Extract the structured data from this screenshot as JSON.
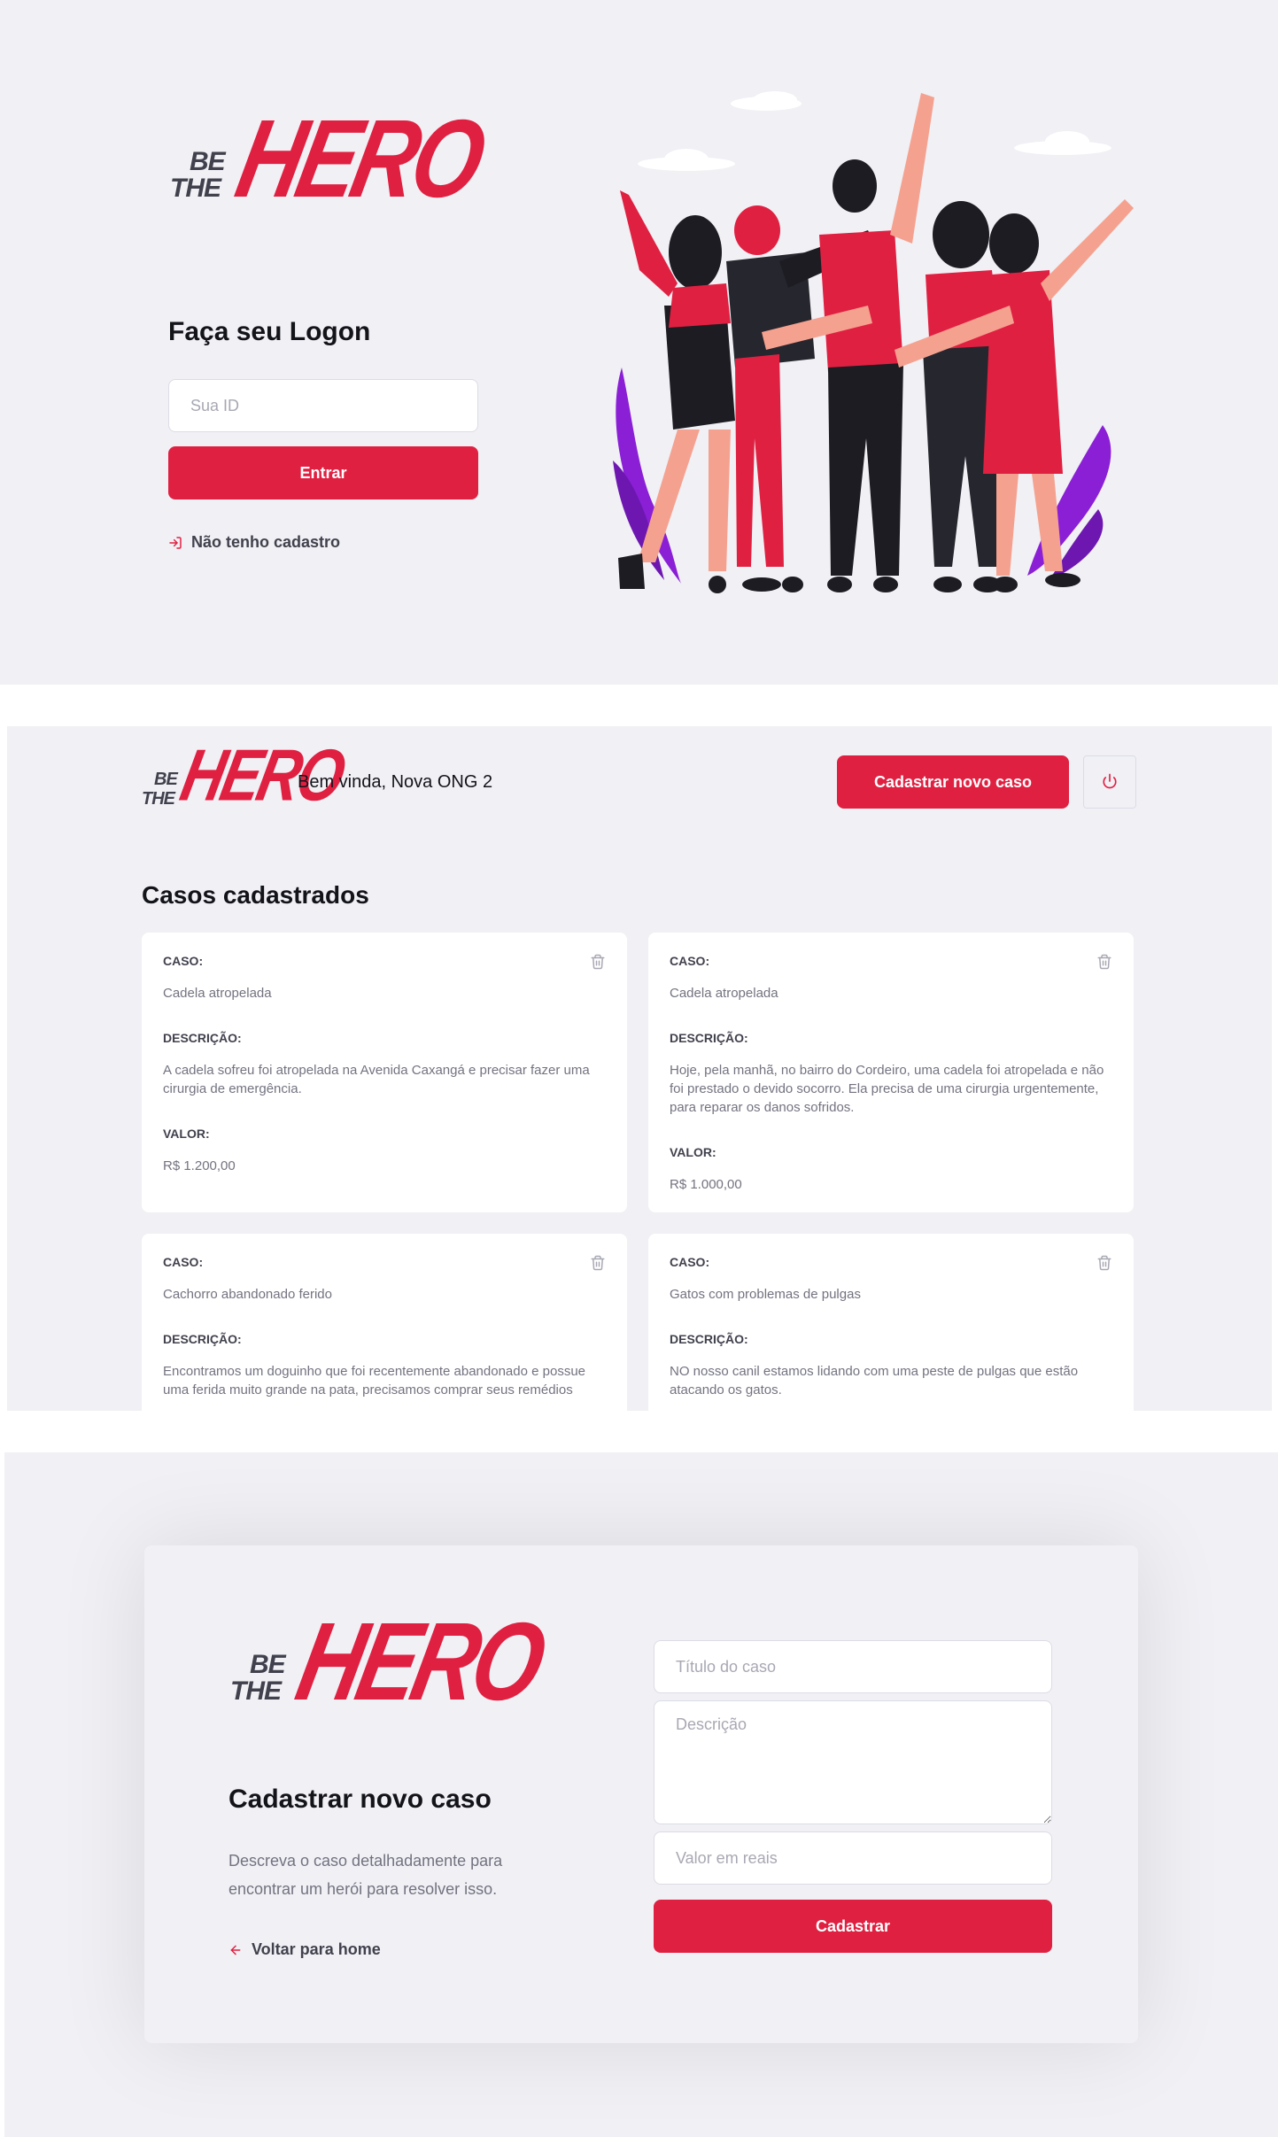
{
  "brand": {
    "logo_be": "BE",
    "logo_the": "THE",
    "logo_hero": "HERO",
    "primary_color": "#e02041",
    "background_color": "#f0f0f5"
  },
  "logon": {
    "title": "Faça seu Logon",
    "id_placeholder": "Sua ID",
    "submit_label": "Entrar",
    "register_link_icon": "log-in-icon",
    "register_link_label": "Não tenho cadastro",
    "illustration": "heroes-group-illustration"
  },
  "profile": {
    "welcome": "Bem vinda, Nova ONG 2",
    "new_case_label": "Cadastrar novo caso",
    "logout_icon": "power-icon",
    "list_title": "Casos cadastrados",
    "labels": {
      "case": "CASO:",
      "description": "DESCRIÇÃO:",
      "value": "VALOR:"
    },
    "cases": [
      {
        "title": "Cadela atropelada",
        "description": "A cadela sofreu foi atropelada na Avenida Caxangá e precisar fazer uma cirurgia de emergência.",
        "value": "R$ 1.200,00"
      },
      {
        "title": "Cadela atropelada",
        "description": "Hoje, pela manhã, no bairro do Cordeiro, uma cadela foi atropelada e não foi prestado o devido socorro. Ela precisa de uma cirurgia urgentemente, para reparar os danos sofridos.",
        "value": "R$ 1.000,00"
      },
      {
        "title": "Cachorro abandonado ferido",
        "description": "Encontramos um doguinho que foi recentemente abandonado e possue uma ferida muito grande na pata, precisamos comprar seus remédios"
      },
      {
        "title": "Gatos com problemas de pulgas",
        "description": "NO nosso canil estamos lidando com uma peste de pulgas que estão atacando os gatos."
      }
    ],
    "trash_icon": "trash-icon"
  },
  "new_incident": {
    "title": "Cadastrar novo caso",
    "description": "Descreva o caso detalhadamente para encontrar um herói para resolver isso.",
    "back_icon": "arrow-left-icon",
    "back_label": "Voltar para home",
    "title_placeholder": "Título do caso",
    "description_placeholder": "Descrição",
    "value_placeholder": "Valor em reais",
    "submit_label": "Cadastrar"
  }
}
